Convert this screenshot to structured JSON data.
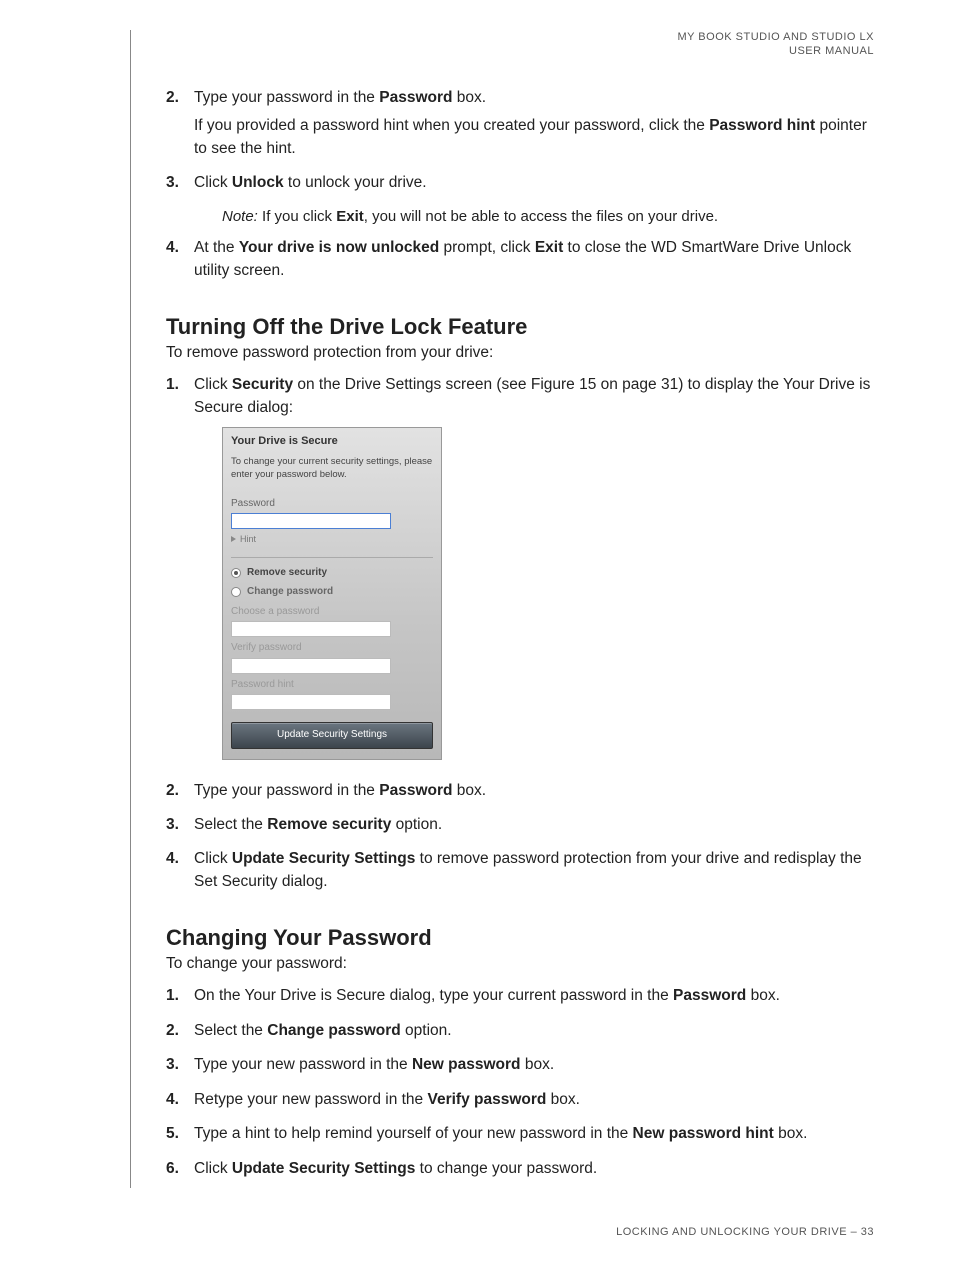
{
  "header": {
    "line1": "MY BOOK STUDIO AND  STUDIO LX",
    "line2": "USER MANUAL"
  },
  "topSteps": {
    "s2": {
      "num": "2.",
      "l1a": "Type your password in the ",
      "l1b": "Password",
      "l1c": " box.",
      "l2a": "If you provided a password hint when you created your password, click the ",
      "l2b": "Password hint",
      "l2c": " pointer to see the hint."
    },
    "s3": {
      "num": "3.",
      "a": "Click ",
      "b": "Unlock",
      "c": " to unlock your drive."
    },
    "note": {
      "a": "Note:",
      "b": "  If you click ",
      "c": "Exit",
      "d": ", you will not be able to access the files on your drive."
    },
    "s4": {
      "num": "4.",
      "a": "At the ",
      "b": "Your drive is now unlocked",
      "c": " prompt, click ",
      "d": "Exit",
      "e": " to close the WD SmartWare Drive Unlock utility screen."
    }
  },
  "sec1": {
    "title": "Turning Off the Drive Lock Feature",
    "intro": "To remove password protection from your drive:",
    "s1": {
      "num": "1.",
      "a": "Click ",
      "b": "Security",
      "c": " on the Drive Settings screen (see Figure 15 on page 31) to display the Your Drive is Secure dialog:"
    },
    "s2": {
      "num": "2.",
      "a": "Type your password in the ",
      "b": "Password",
      "c": " box."
    },
    "s3": {
      "num": "3.",
      "a": "Select the ",
      "b": "Remove security",
      "c": " option."
    },
    "s4": {
      "num": "4.",
      "a": "Click ",
      "b": "Update Security Settings",
      "c": " to remove password protection from your drive and redisplay the Set Security dialog."
    }
  },
  "dialog": {
    "title": "Your Drive is Secure",
    "msg": "To change your current security settings, please enter your password below.",
    "pwdLabel": "Password",
    "hint": "Hint",
    "optRemove": "Remove security",
    "optChange": "Change password",
    "chooseLabel": "Choose a password",
    "verifyLabel": "Verify password",
    "hintLabel": "Password hint",
    "button": "Update Security Settings"
  },
  "sec2": {
    "title": "Changing Your Password",
    "intro": "To change your password:",
    "s1": {
      "num": "1.",
      "a": "On the Your Drive is Secure dialog, type your current password in the ",
      "b": "Password",
      "c": " box."
    },
    "s2": {
      "num": "2.",
      "a": "Select the ",
      "b": "Change password",
      "c": " option."
    },
    "s3": {
      "num": "3.",
      "a": "Type your new password in the ",
      "b": "New password",
      "c": " box."
    },
    "s4": {
      "num": "4.",
      "a": "Retype your new password in the ",
      "b": "Verify password",
      "c": " box."
    },
    "s5": {
      "num": "5.",
      "a": "Type a hint to help remind yourself of your new password in the ",
      "b": "New password hint",
      "c": " box."
    },
    "s6": {
      "num": "6.",
      "a": "Click ",
      "b": "Update Security Settings",
      "c": " to change your password."
    }
  },
  "footer": "LOCKING AND UNLOCKING YOUR DRIVE – 33"
}
